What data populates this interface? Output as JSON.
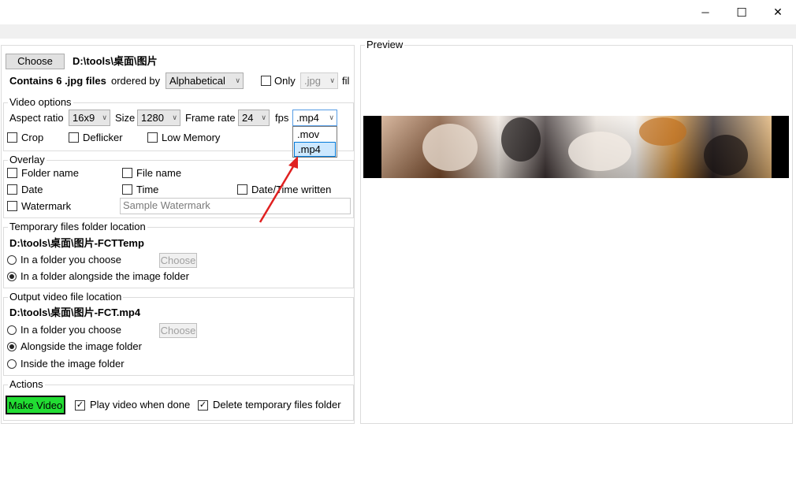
{
  "window": {
    "minimize_symbol": "─",
    "maximize_symbol": "☐",
    "close_symbol": "✕"
  },
  "source": {
    "choose_label": "Choose",
    "path": "D:\\tools\\桌面\\图片",
    "contains": "Contains 6 .jpg files",
    "ordered_by_label": "ordered by",
    "order_value": "Alphabetical",
    "only_label": "Only",
    "only_ext_value": ".jpg",
    "fil_label": "fil"
  },
  "video_options": {
    "legend": "Video options",
    "aspect_ratio_label": "Aspect ratio",
    "aspect_ratio_value": "16x9",
    "size_label": "Size",
    "size_value": "1280",
    "frame_rate_label": "Frame rate",
    "frame_rate_value": "24",
    "fps_label": "fps",
    "format_value": ".mp4",
    "format_options": [
      ".mov",
      ".mp4"
    ],
    "crop_label": "Crop",
    "deflicker_label": "Deflicker",
    "low_memory_label": "Low Memory"
  },
  "overlay": {
    "legend": "Overlay",
    "folder_name_label": "Folder name",
    "file_name_label": "File name",
    "date_label": "Date",
    "time_label": "Time",
    "date_time_written_label": "Date/Time written",
    "watermark_label": "Watermark",
    "watermark_value": "Sample Watermark"
  },
  "temp_folder": {
    "legend": "Temporary files folder location",
    "path": "D:\\tools\\桌面\\图片-FCTTemp",
    "option_choose_label": "In a folder you choose",
    "choose_label": "Choose",
    "option_alongside_label": "In a folder alongside the image folder"
  },
  "output": {
    "legend": "Output video file location",
    "path": "D:\\tools\\桌面\\图片-FCT.mp4",
    "option_choose_label": "In a folder you choose",
    "choose_label": "Choose",
    "option_alongside_label": "Alongside the image folder",
    "option_inside_label": "Inside the image folder"
  },
  "actions": {
    "legend": "Actions",
    "make_video_label": "Make Video",
    "play_when_done_label": "Play video when done",
    "delete_temp_label": "Delete temporary files folder",
    "make_video_color": "#22dd33"
  },
  "preview": {
    "legend": "Preview"
  }
}
